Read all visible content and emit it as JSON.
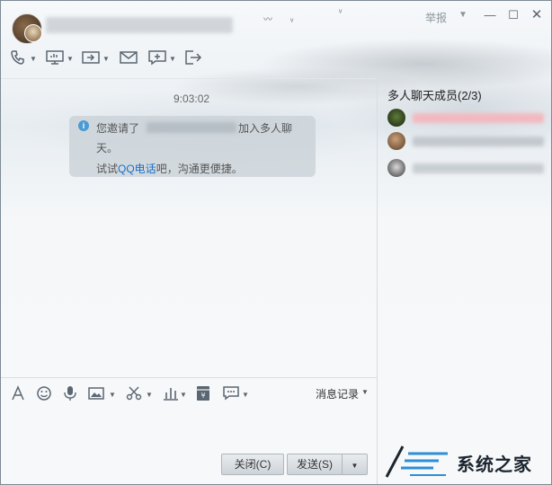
{
  "window": {
    "report_label": "举报",
    "controls": [
      "minimize",
      "maximize",
      "close"
    ]
  },
  "toolbar": {
    "items": [
      "phone-icon",
      "screen-share-icon",
      "transfer-file-icon",
      "mail-icon",
      "add-app-icon",
      "exit-icon"
    ]
  },
  "chat": {
    "time": "9:03:02",
    "notice": {
      "line1_prefix": "您邀请了",
      "line1_suffix": "加入多人聊",
      "line2": "天。",
      "line3_prefix": "试试",
      "link": "QQ电话",
      "line3_suffix": "吧，沟通更便捷。"
    }
  },
  "input_toolbar": {
    "items": [
      "font-icon",
      "emoji-icon",
      "voice-icon",
      "image-icon",
      "screenshot-scissors-icon",
      "music-bars-icon",
      "red-packet-icon",
      "more-app-icon"
    ],
    "history_label": "消息记录"
  },
  "buttons": {
    "close_label": "关闭(C)",
    "send_label": "发送(S)"
  },
  "members": {
    "title": "多人聊天成员(2/3)",
    "count": 3
  },
  "watermark": {
    "text": "系统之家"
  }
}
